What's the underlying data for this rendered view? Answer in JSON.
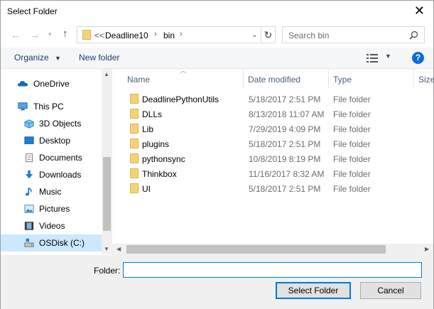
{
  "window": {
    "title": "Select Folder"
  },
  "address": {
    "overflow": "<<",
    "crumbs": [
      "Deadline10",
      "bin"
    ]
  },
  "search": {
    "placeholder": "Search bin"
  },
  "toolbar": {
    "organize": "Organize",
    "new_folder": "New folder"
  },
  "nav": {
    "items": [
      {
        "label": "OneDrive",
        "icon": "onedrive-icon",
        "indent": 1
      },
      {
        "label": "This PC",
        "icon": "pc-icon",
        "indent": 1
      },
      {
        "label": "3D Objects",
        "icon": "3d-objects-icon",
        "indent": 2
      },
      {
        "label": "Desktop",
        "icon": "desktop-icon",
        "indent": 2
      },
      {
        "label": "Documents",
        "icon": "documents-icon",
        "indent": 2
      },
      {
        "label": "Downloads",
        "icon": "downloads-icon",
        "indent": 2
      },
      {
        "label": "Music",
        "icon": "music-icon",
        "indent": 2
      },
      {
        "label": "Pictures",
        "icon": "pictures-icon",
        "indent": 2
      },
      {
        "label": "Videos",
        "icon": "videos-icon",
        "indent": 2
      },
      {
        "label": "OSDisk (C:)",
        "icon": "drive-icon",
        "indent": 2
      }
    ],
    "selected": "OSDisk (C:)"
  },
  "list": {
    "columns": [
      "Name",
      "Date modified",
      "Type",
      "Size"
    ],
    "rows": [
      {
        "name": "DeadlinePythonUtils",
        "date": "5/18/2017 2:51 PM",
        "type": "File folder"
      },
      {
        "name": "DLLs",
        "date": "8/13/2018 11:07 AM",
        "type": "File folder"
      },
      {
        "name": "Lib",
        "date": "7/29/2019 4:09 PM",
        "type": "File folder"
      },
      {
        "name": "plugins",
        "date": "5/18/2017 2:51 PM",
        "type": "File folder"
      },
      {
        "name": "pythonsync",
        "date": "10/8/2019 8:19 PM",
        "type": "File folder"
      },
      {
        "name": "Thinkbox",
        "date": "11/16/2017 8:32 AM",
        "type": "File folder"
      },
      {
        "name": "UI",
        "date": "5/18/2017 2:51 PM",
        "type": "File folder"
      }
    ]
  },
  "footer": {
    "folder_label": "Folder:",
    "folder_value": "",
    "select_button": "Select Folder",
    "cancel_button": "Cancel"
  },
  "colors": {
    "accent": "#0078d7",
    "selection": "#cce8ff",
    "folder": "#f4d27a"
  }
}
